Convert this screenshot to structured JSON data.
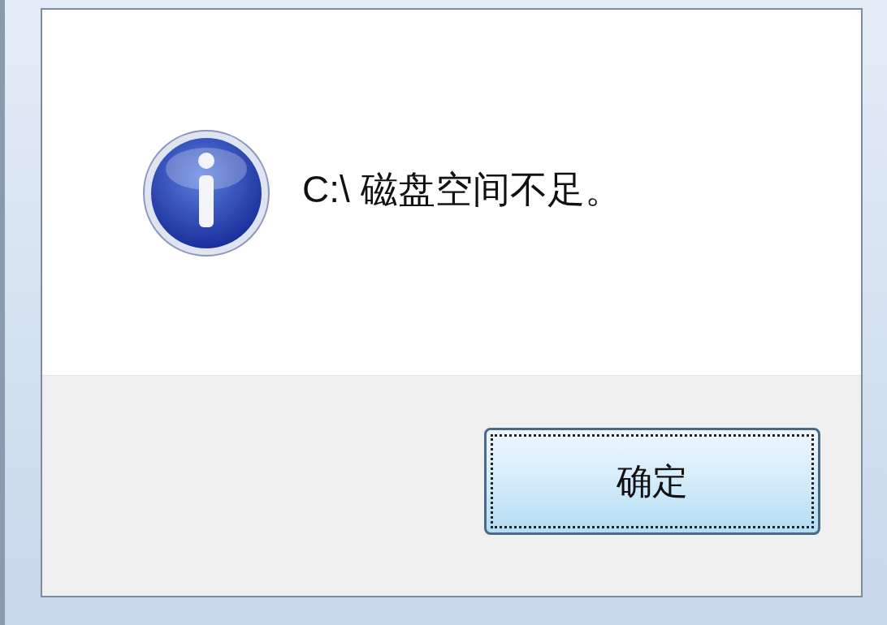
{
  "message": {
    "text": "C:\\ 磁盘空间不足。"
  },
  "buttons": [
    {
      "label": "确定",
      "focused": true
    }
  ]
}
